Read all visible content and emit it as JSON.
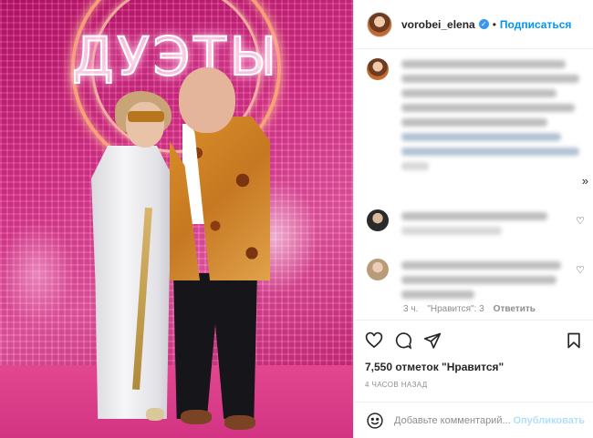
{
  "photo": {
    "neon_sign": "ДУЭТЫ"
  },
  "header": {
    "username": "vorobei_elena",
    "separator": "•",
    "follow_label": "Подписаться",
    "verified_glyph": "✓"
  },
  "comments": {
    "more_glyph": "»",
    "heart_glyph": "♡",
    "reply_meta": {
      "time": "3 ч.",
      "likes": "\"Нравится\": 3",
      "reply": "Ответить"
    }
  },
  "actions": {
    "icons": [
      "heart-icon",
      "comment-icon",
      "share-icon",
      "bookmark-icon"
    ]
  },
  "post": {
    "likes_text": "7,550 отметок \"Нравится\"",
    "time_text": "4 ЧАСОВ НАЗАД"
  },
  "add_comment": {
    "placeholder": "Добавьте комментарий...",
    "publish_label": "Опубликовать"
  },
  "colors": {
    "accent": "#0095f6",
    "publish_disabled": "#b2dffc",
    "photo_pink": "#e2338f"
  }
}
